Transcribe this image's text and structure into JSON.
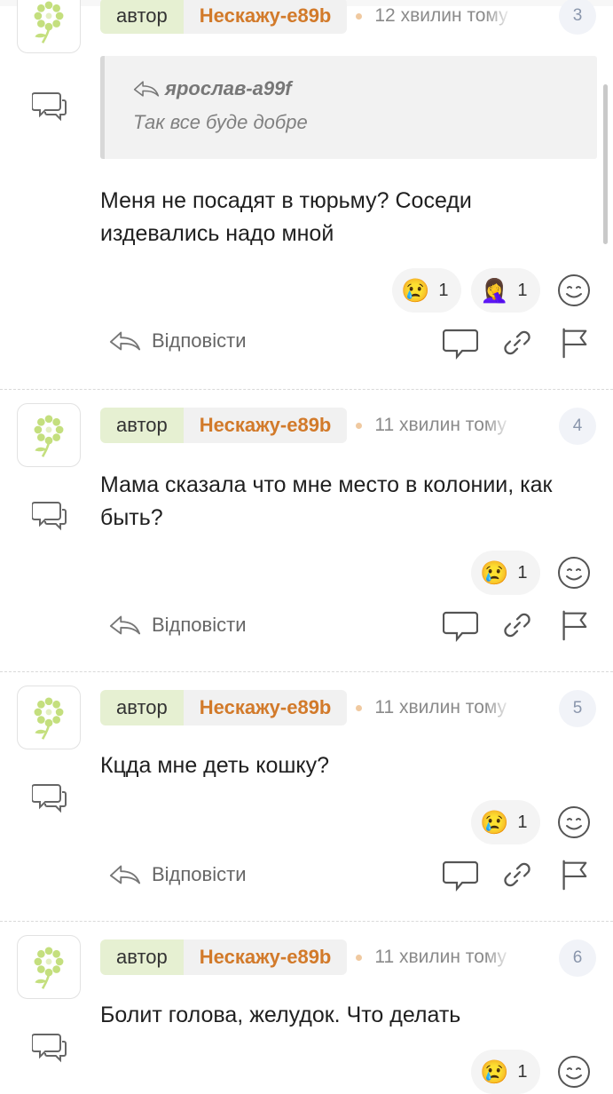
{
  "comments": [
    {
      "author_tag": "автор",
      "author_name": "Нескажу-e89b",
      "time": "12 хвилин тому",
      "number": "3",
      "quote": {
        "author": "ярослав-a99f",
        "text": "Так все буде добре"
      },
      "text": "Меня не посадят в тюрьму? Соседи издевались надо мной",
      "reactions": [
        {
          "emoji": "😢",
          "count": "1"
        },
        {
          "emoji": "🤦‍♀️",
          "count": "1"
        }
      ],
      "reply_label": "Відповісти"
    },
    {
      "author_tag": "автор",
      "author_name": "Нескажу-e89b",
      "time": "11 хвилин тому",
      "number": "4",
      "text": "Мама сказала что мне место в колонии, как быть?",
      "reactions": [
        {
          "emoji": "😢",
          "count": "1"
        }
      ],
      "reply_label": "Відповісти"
    },
    {
      "author_tag": "автор",
      "author_name": "Нескажу-e89b",
      "time": "11 хвилин тому",
      "number": "5",
      "text": "Кцда мне деть кошку?",
      "reactions": [
        {
          "emoji": "😢",
          "count": "1"
        }
      ],
      "reply_label": "Відповісти"
    },
    {
      "author_tag": "автор",
      "author_name": "Нескажу-e89b",
      "time": "11 хвилин тому",
      "number": "6",
      "text": "Болит голова, желудок. Что делать",
      "reactions": [
        {
          "emoji": "😢",
          "count": "1"
        }
      ]
    }
  ],
  "icons": {
    "avatar": "flower-icon",
    "side": "chat-bubbles-icon",
    "reply": "reply-arrow-icon",
    "actions": [
      "comment-icon",
      "link-icon",
      "flag-icon"
    ],
    "add_reaction": "smile-icon"
  },
  "colors": {
    "author_name": "#d27a2a",
    "author_tag_bg": "#e6f0d2",
    "avatar_flower": "#b5d86a"
  }
}
